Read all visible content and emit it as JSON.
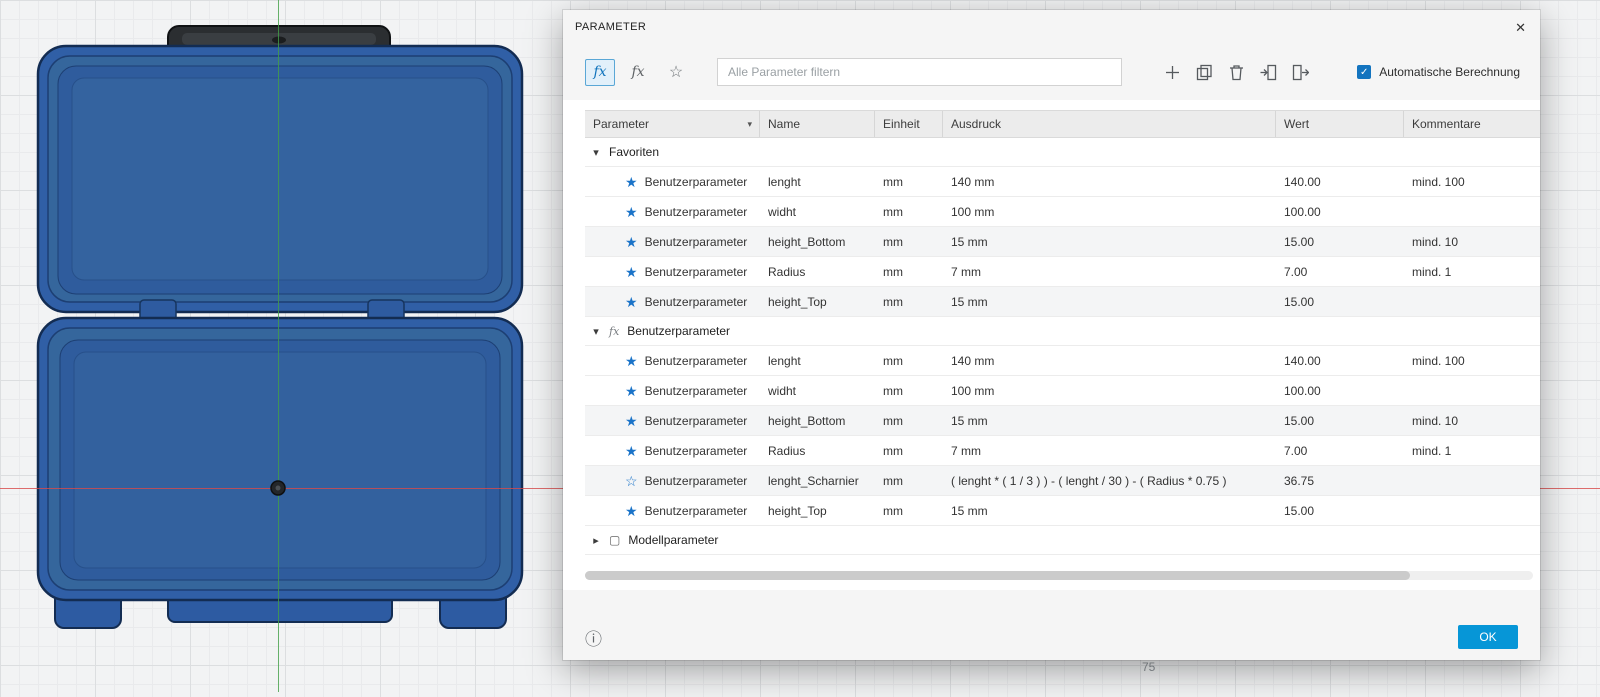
{
  "icons": {
    "close": "✕",
    "chevron_down": "▾",
    "chevron_right": "▸",
    "sort_down": "▾",
    "star_outline": "☆",
    "fx": "fx",
    "box": "▢",
    "info": "ⓘ",
    "check": "✓"
  },
  "canvas": {
    "ruler_label": "75"
  },
  "dialog": {
    "title": "PARAMETER",
    "toolbar": {
      "filter_placeholder": "Alle Parameter filtern",
      "auto_label": "Automatische Berechnung"
    },
    "table": {
      "headers": {
        "parameter": "Parameter",
        "name": "Name",
        "einheit": "Einheit",
        "ausdruck": "Ausdruck",
        "wert": "Wert",
        "kommentare": "Kommentare"
      },
      "groups": [
        {
          "label": "Favoriten",
          "rows": [
            {
              "star": "★",
              "parameter": "Benutzerparameter",
              "name": "lenght",
              "einheit": "mm",
              "ausdruck": "140 mm",
              "wert": "140.00",
              "kommentar": "mind. 100"
            },
            {
              "star": "★",
              "parameter": "Benutzerparameter",
              "name": "widht",
              "einheit": "mm",
              "ausdruck": "100 mm",
              "wert": "100.00",
              "kommentar": ""
            },
            {
              "star": "★",
              "parameter": "Benutzerparameter",
              "name": "height_Bottom",
              "einheit": "mm",
              "ausdruck": "15 mm",
              "wert": "15.00",
              "kommentar": "mind. 10"
            },
            {
              "star": "★",
              "parameter": "Benutzerparameter",
              "name": "Radius",
              "einheit": "mm",
              "ausdruck": "7 mm",
              "wert": "7.00",
              "kommentar": "mind. 1"
            },
            {
              "star": "★",
              "parameter": "Benutzerparameter",
              "name": "height_Top",
              "einheit": "mm",
              "ausdruck": "15 mm",
              "wert": "15.00",
              "kommentar": ""
            }
          ]
        },
        {
          "label": "Benutzerparameter",
          "rows": [
            {
              "star": "★",
              "parameter": "Benutzerparameter",
              "name": "lenght",
              "einheit": "mm",
              "ausdruck": "140 mm",
              "wert": "140.00",
              "kommentar": "mind. 100"
            },
            {
              "star": "★",
              "parameter": "Benutzerparameter",
              "name": "widht",
              "einheit": "mm",
              "ausdruck": "100 mm",
              "wert": "100.00",
              "kommentar": ""
            },
            {
              "star": "★",
              "parameter": "Benutzerparameter",
              "name": "height_Bottom",
              "einheit": "mm",
              "ausdruck": "15 mm",
              "wert": "15.00",
              "kommentar": "mind. 10"
            },
            {
              "star": "★",
              "parameter": "Benutzerparameter",
              "name": "Radius",
              "einheit": "mm",
              "ausdruck": "7 mm",
              "wert": "7.00",
              "kommentar": "mind. 1"
            },
            {
              "star": "☆",
              "parameter": "Benutzerparameter",
              "name": "lenght_Scharnier",
              "einheit": "mm",
              "ausdruck": "( lenght * ( 1 / 3 ) ) - ( lenght / 30 ) - ( Radius * 0.75 )",
              "wert": "36.75",
              "kommentar": ""
            },
            {
              "star": "★",
              "parameter": "Benutzerparameter",
              "name": "height_Top",
              "einheit": "mm",
              "ausdruck": "15 mm",
              "wert": "15.00",
              "kommentar": ""
            }
          ]
        },
        {
          "label": "Modellparameter",
          "rows": []
        }
      ]
    },
    "ok_label": "OK"
  }
}
